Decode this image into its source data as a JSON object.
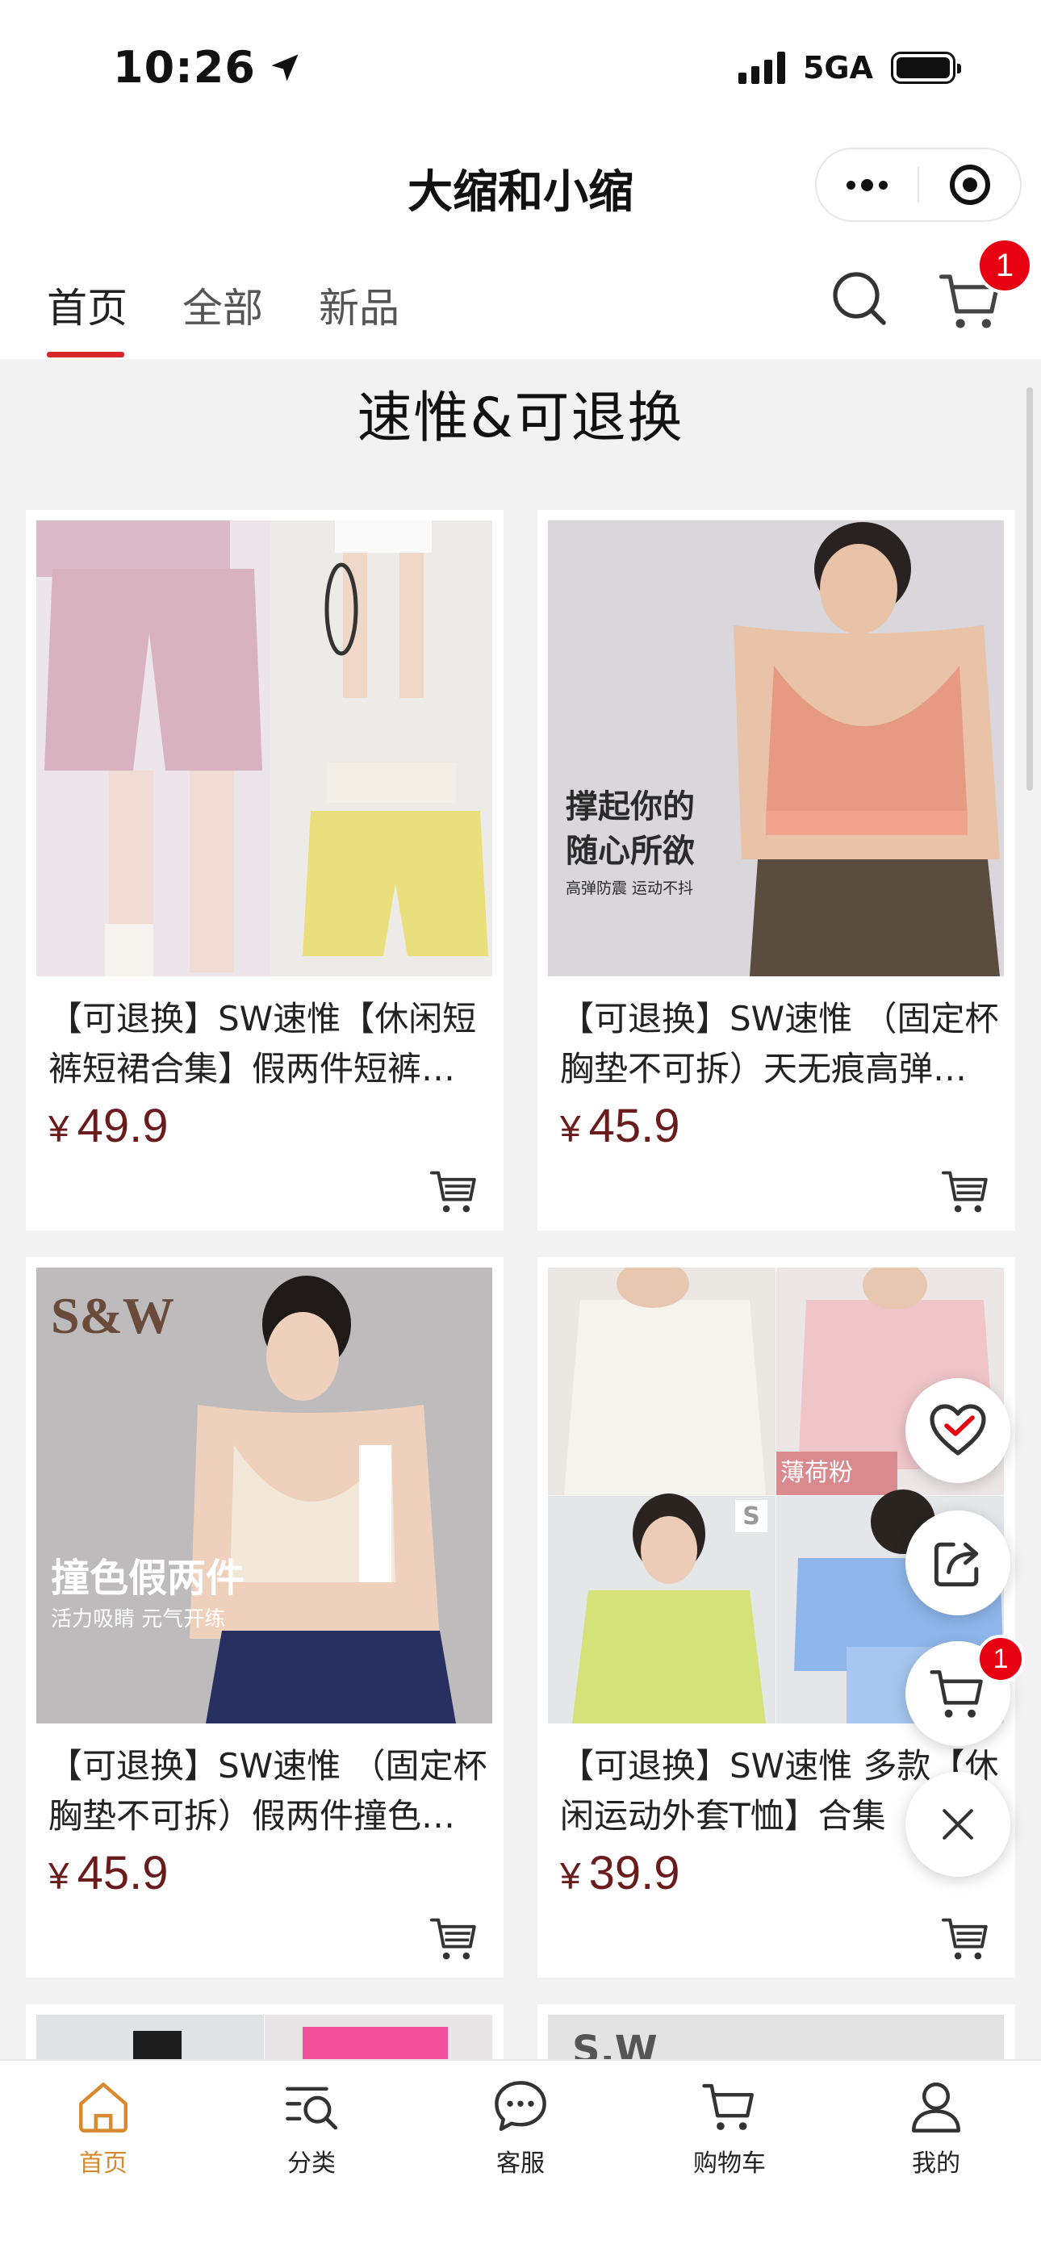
{
  "status_bar": {
    "time": "10:26",
    "network": "5GA"
  },
  "header": {
    "title": "大缩和小缩"
  },
  "nav": {
    "tabs": [
      {
        "label": "首页",
        "active": true
      },
      {
        "label": "全部",
        "active": false
      },
      {
        "label": "新品",
        "active": false
      }
    ],
    "cart_badge": "1"
  },
  "section": {
    "heading": "速惟&可退换"
  },
  "products": [
    {
      "title": "【可退换】SW速惟【休闲短裤短裙合集】假两件短裤短裙",
      "currency": "¥",
      "price": "49.9"
    },
    {
      "title": "【可退换】SW速惟 （固定杯胸垫不可拆）天无痕高弹裸感运动内衣",
      "currency": "¥",
      "price": "45.9",
      "image_text": {
        "line1": "撑起你的",
        "line2": "随心所欲",
        "line3": "高弹防震 运动不抖"
      }
    },
    {
      "title": "【可退换】SW速惟 （固定杯胸垫不可拆）假两件撞色内衣",
      "currency": "¥",
      "price": "45.9",
      "image_text": {
        "logo": "S&W",
        "line1": "撞色假两件",
        "line2": "活力吸睛 元气开练"
      }
    },
    {
      "title": "【可退换】SW速惟 多款【休闲运动外套T恤】合集",
      "currency": "¥",
      "price": "39.9",
      "image_text": {
        "tag": "薄荷粉",
        "badge": "S"
      }
    },
    {
      "title": "",
      "currency": "¥",
      "price": ""
    },
    {
      "title": "",
      "currency": "¥",
      "price": "",
      "image_text": {
        "logo": "S.W"
      }
    }
  ],
  "floating": {
    "cart_badge": "1"
  },
  "tab_bar": {
    "items": [
      {
        "label": "首页",
        "icon": "home-icon",
        "active": true
      },
      {
        "label": "分类",
        "icon": "category-search-icon",
        "active": false
      },
      {
        "label": "客服",
        "icon": "chat-bubble-icon",
        "active": false
      },
      {
        "label": "购物车",
        "icon": "cart-icon",
        "active": false
      },
      {
        "label": "我的",
        "icon": "user-icon",
        "active": false
      }
    ]
  },
  "colors": {
    "accent_red": "#d8262c",
    "price": "#6a1c1c",
    "active_tab": "#d98a2e",
    "badge": "#e60012"
  }
}
